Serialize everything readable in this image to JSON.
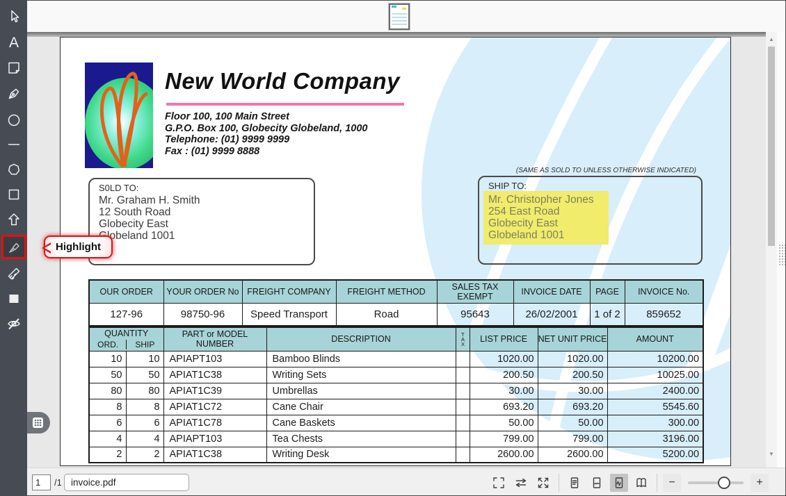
{
  "colors": {
    "accent_red": "#e01212",
    "highlight_yellow": "#f1ec6b",
    "header_teal": "#a7d4d8",
    "brand_pink": "#f973ae",
    "watermark_blue": "#d8eefa",
    "sidebar_bg": "#474c54"
  },
  "sidebar": {
    "tool_icons": [
      "pointer-icon",
      "text-icon",
      "note-icon",
      "pen-icon",
      "ellipse-icon",
      "line-icon",
      "polygon-icon",
      "rectangle-icon",
      "block-arrow-icon",
      "highlighter-icon",
      "ruler-icon",
      "filled-rectangle-icon",
      "hide-annotations-icon",
      "grid-icon"
    ],
    "text_tool_glyph": "A",
    "selected_tool": "highlighter"
  },
  "tooltip": {
    "label": "Highlight"
  },
  "document": {
    "company": {
      "name": "New World Company",
      "address_lines": [
        "Floor 100, 100 Main Street",
        "G.P.O. Box 100, Globecity Globeland, 1000",
        "Telephone: (01) 9999 9999",
        "Fax : (01) 9999 8888"
      ]
    },
    "sold_to": {
      "label": "S0LD TO:",
      "lines": [
        "Mr. Graham H. Smith",
        "12 South Road",
        "Globecity East",
        "Globeland 1001"
      ]
    },
    "ship_to": {
      "note": "(SAME AS SOLD TO UNLESS OTHERWISE INDICATED)",
      "label": "SHIP TO:",
      "lines": [
        "Mr. Christopher Jones",
        "254 East Road",
        "Globecity East",
        "Globeland 1001"
      ]
    },
    "order_info": {
      "headers": [
        "OUR ORDER",
        "YOUR ORDER No",
        "FREIGHT COMPANY",
        "FREIGHT METHOD",
        "SALES TAX EXEMPT",
        "INVOICE DATE",
        "PAGE",
        "INVOICE No."
      ],
      "values": [
        "127-96",
        "98750-96",
        "Speed Transport",
        "Road",
        "95643",
        "26/02/2001",
        "1 of 2",
        "859652"
      ]
    },
    "items": {
      "headers": {
        "quantity": "QUANTITY",
        "ord": "ORD.",
        "ship": "SHIP",
        "part": "PART or MODEL NUMBER",
        "description": "DESCRIPTION",
        "tax": "TAX",
        "list_price": "LIST PRICE",
        "net_unit_price": "NET UNIT PRICE",
        "amount": "AMOUNT"
      },
      "rows": [
        {
          "ord": "10",
          "ship": "10",
          "part": "APIAPT103",
          "description": "Bamboo Blinds",
          "list": "1020.00",
          "net": "1020.00",
          "amount": "10200.00"
        },
        {
          "ord": "50",
          "ship": "50",
          "part": "APIAT1C38",
          "description": "Writing Sets",
          "list": "200.50",
          "net": "200.50",
          "amount": "10025.00"
        },
        {
          "ord": "80",
          "ship": "80",
          "part": "APIAT1C39",
          "description": "Umbrellas",
          "list": "30.00",
          "net": "30.00",
          "amount": "2400.00"
        },
        {
          "ord": "8",
          "ship": "8",
          "part": "APIAT1C72",
          "description": "Cane Chair",
          "list": "693.20",
          "net": "693.20",
          "amount": "5545.60"
        },
        {
          "ord": "6",
          "ship": "6",
          "part": "APIAT1C78",
          "description": "Cane Baskets",
          "list": "50.00",
          "net": "50.00",
          "amount": "300.00"
        },
        {
          "ord": "4",
          "ship": "4",
          "part": "APIAPT103",
          "description": "Tea Chests",
          "list": "799.00",
          "net": "799.00",
          "amount": "3196.00"
        },
        {
          "ord": "2",
          "ship": "2",
          "part": "APIAT1C38",
          "description": "Writing Desk",
          "list": "2600.00",
          "net": "2600.00",
          "amount": "5200.00"
        }
      ]
    }
  },
  "bottombar": {
    "page_number": "1",
    "page_total": "/1",
    "filename": "invoice.pdf",
    "view_icons": [
      "fit-screen-icon",
      "fit-width-arrows-icon",
      "expand-arrows-icon",
      "single-page-view-icon",
      "page-curl-view-icon",
      "continuous-scroll-view-icon",
      "book-view-icon"
    ],
    "selected_view": "continuous-scroll-view",
    "zoom_minus": "−",
    "zoom_plus": "+"
  }
}
